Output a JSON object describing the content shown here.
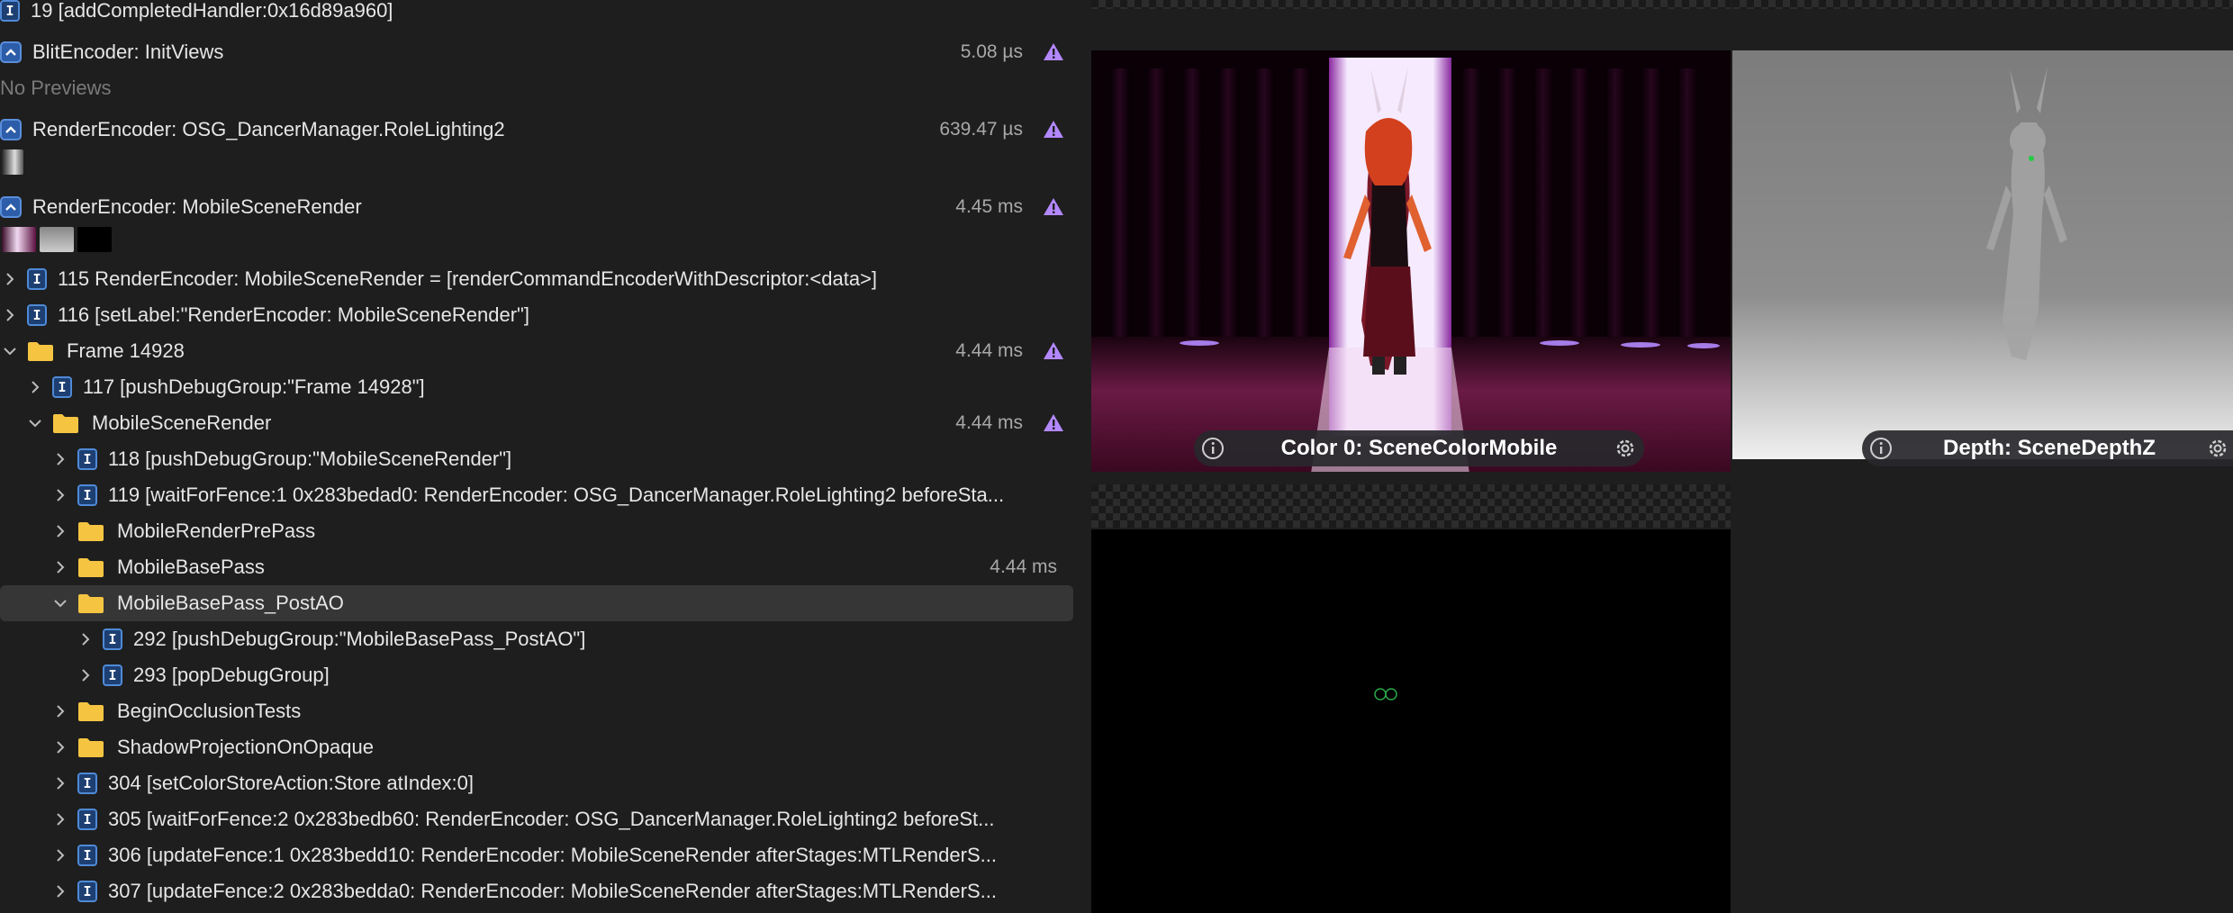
{
  "tree": {
    "rows": [
      {
        "label": "19 [addCompletedHandler:0x16d89a960]"
      },
      {
        "label": "BlitEncoder: InitViews",
        "time": "5.08 µs"
      },
      {
        "label": "No Previews"
      },
      {
        "label": "RenderEncoder: OSG_DancerManager.RoleLighting2",
        "time": "639.47 µs"
      },
      {
        "label": "RenderEncoder: MobileSceneRender",
        "time": "4.45 ms"
      },
      {
        "label": "115 RenderEncoder: MobileSceneRender = [renderCommandEncoderWithDescriptor:<data>]"
      },
      {
        "label": "116 [setLabel:\"RenderEncoder: MobileSceneRender\"]"
      },
      {
        "label": "Frame 14928",
        "time": "4.44 ms"
      },
      {
        "label": "117 [pushDebugGroup:\"Frame 14928\"]"
      },
      {
        "label": "MobileSceneRender",
        "time": "4.44 ms"
      },
      {
        "label": "118 [pushDebugGroup:\"MobileSceneRender\"]"
      },
      {
        "label": "119 [waitForFence:1 0x283bedad0: RenderEncoder: OSG_DancerManager.RoleLighting2 beforeSta..."
      },
      {
        "label": "MobileRenderPrePass"
      },
      {
        "label": "MobileBasePass",
        "time": "4.44 ms"
      },
      {
        "label": "MobileBasePass_PostAO"
      },
      {
        "label": "292 [pushDebugGroup:\"MobileBasePass_PostAO\"]"
      },
      {
        "label": "293 [popDebugGroup]"
      },
      {
        "label": "BeginOcclusionTests"
      },
      {
        "label": "ShadowProjectionOnOpaque"
      },
      {
        "label": "304 [setColorStoreAction:Store atIndex:0]"
      },
      {
        "label": "305 [waitForFence:2 0x283bedb60: RenderEncoder: OSG_DancerManager.RoleLighting2 beforeSt..."
      },
      {
        "label": "306 [updateFence:1 0x283bedd10: RenderEncoder: MobileSceneRender afterStages:MTLRenderS..."
      },
      {
        "label": "307 [updateFence:2 0x283bedda0: RenderEncoder: MobileSceneRender afterStages:MTLRenderS..."
      }
    ]
  },
  "viewer": {
    "color": {
      "label": "Color 0: SceneColorMobile"
    },
    "depth": {
      "label": "Depth: SceneDepthZ"
    }
  },
  "icons": [
    "chevron-right-icon",
    "chevron-down-icon",
    "command-badge-icon",
    "collapse-badge-icon",
    "folder-icon",
    "warning-icon",
    "info-icon",
    "gear-icon"
  ],
  "colors": {
    "accent": "#2d5da8",
    "folder": "#f5c542",
    "warning": "#b388ff",
    "selection": "#363637"
  }
}
